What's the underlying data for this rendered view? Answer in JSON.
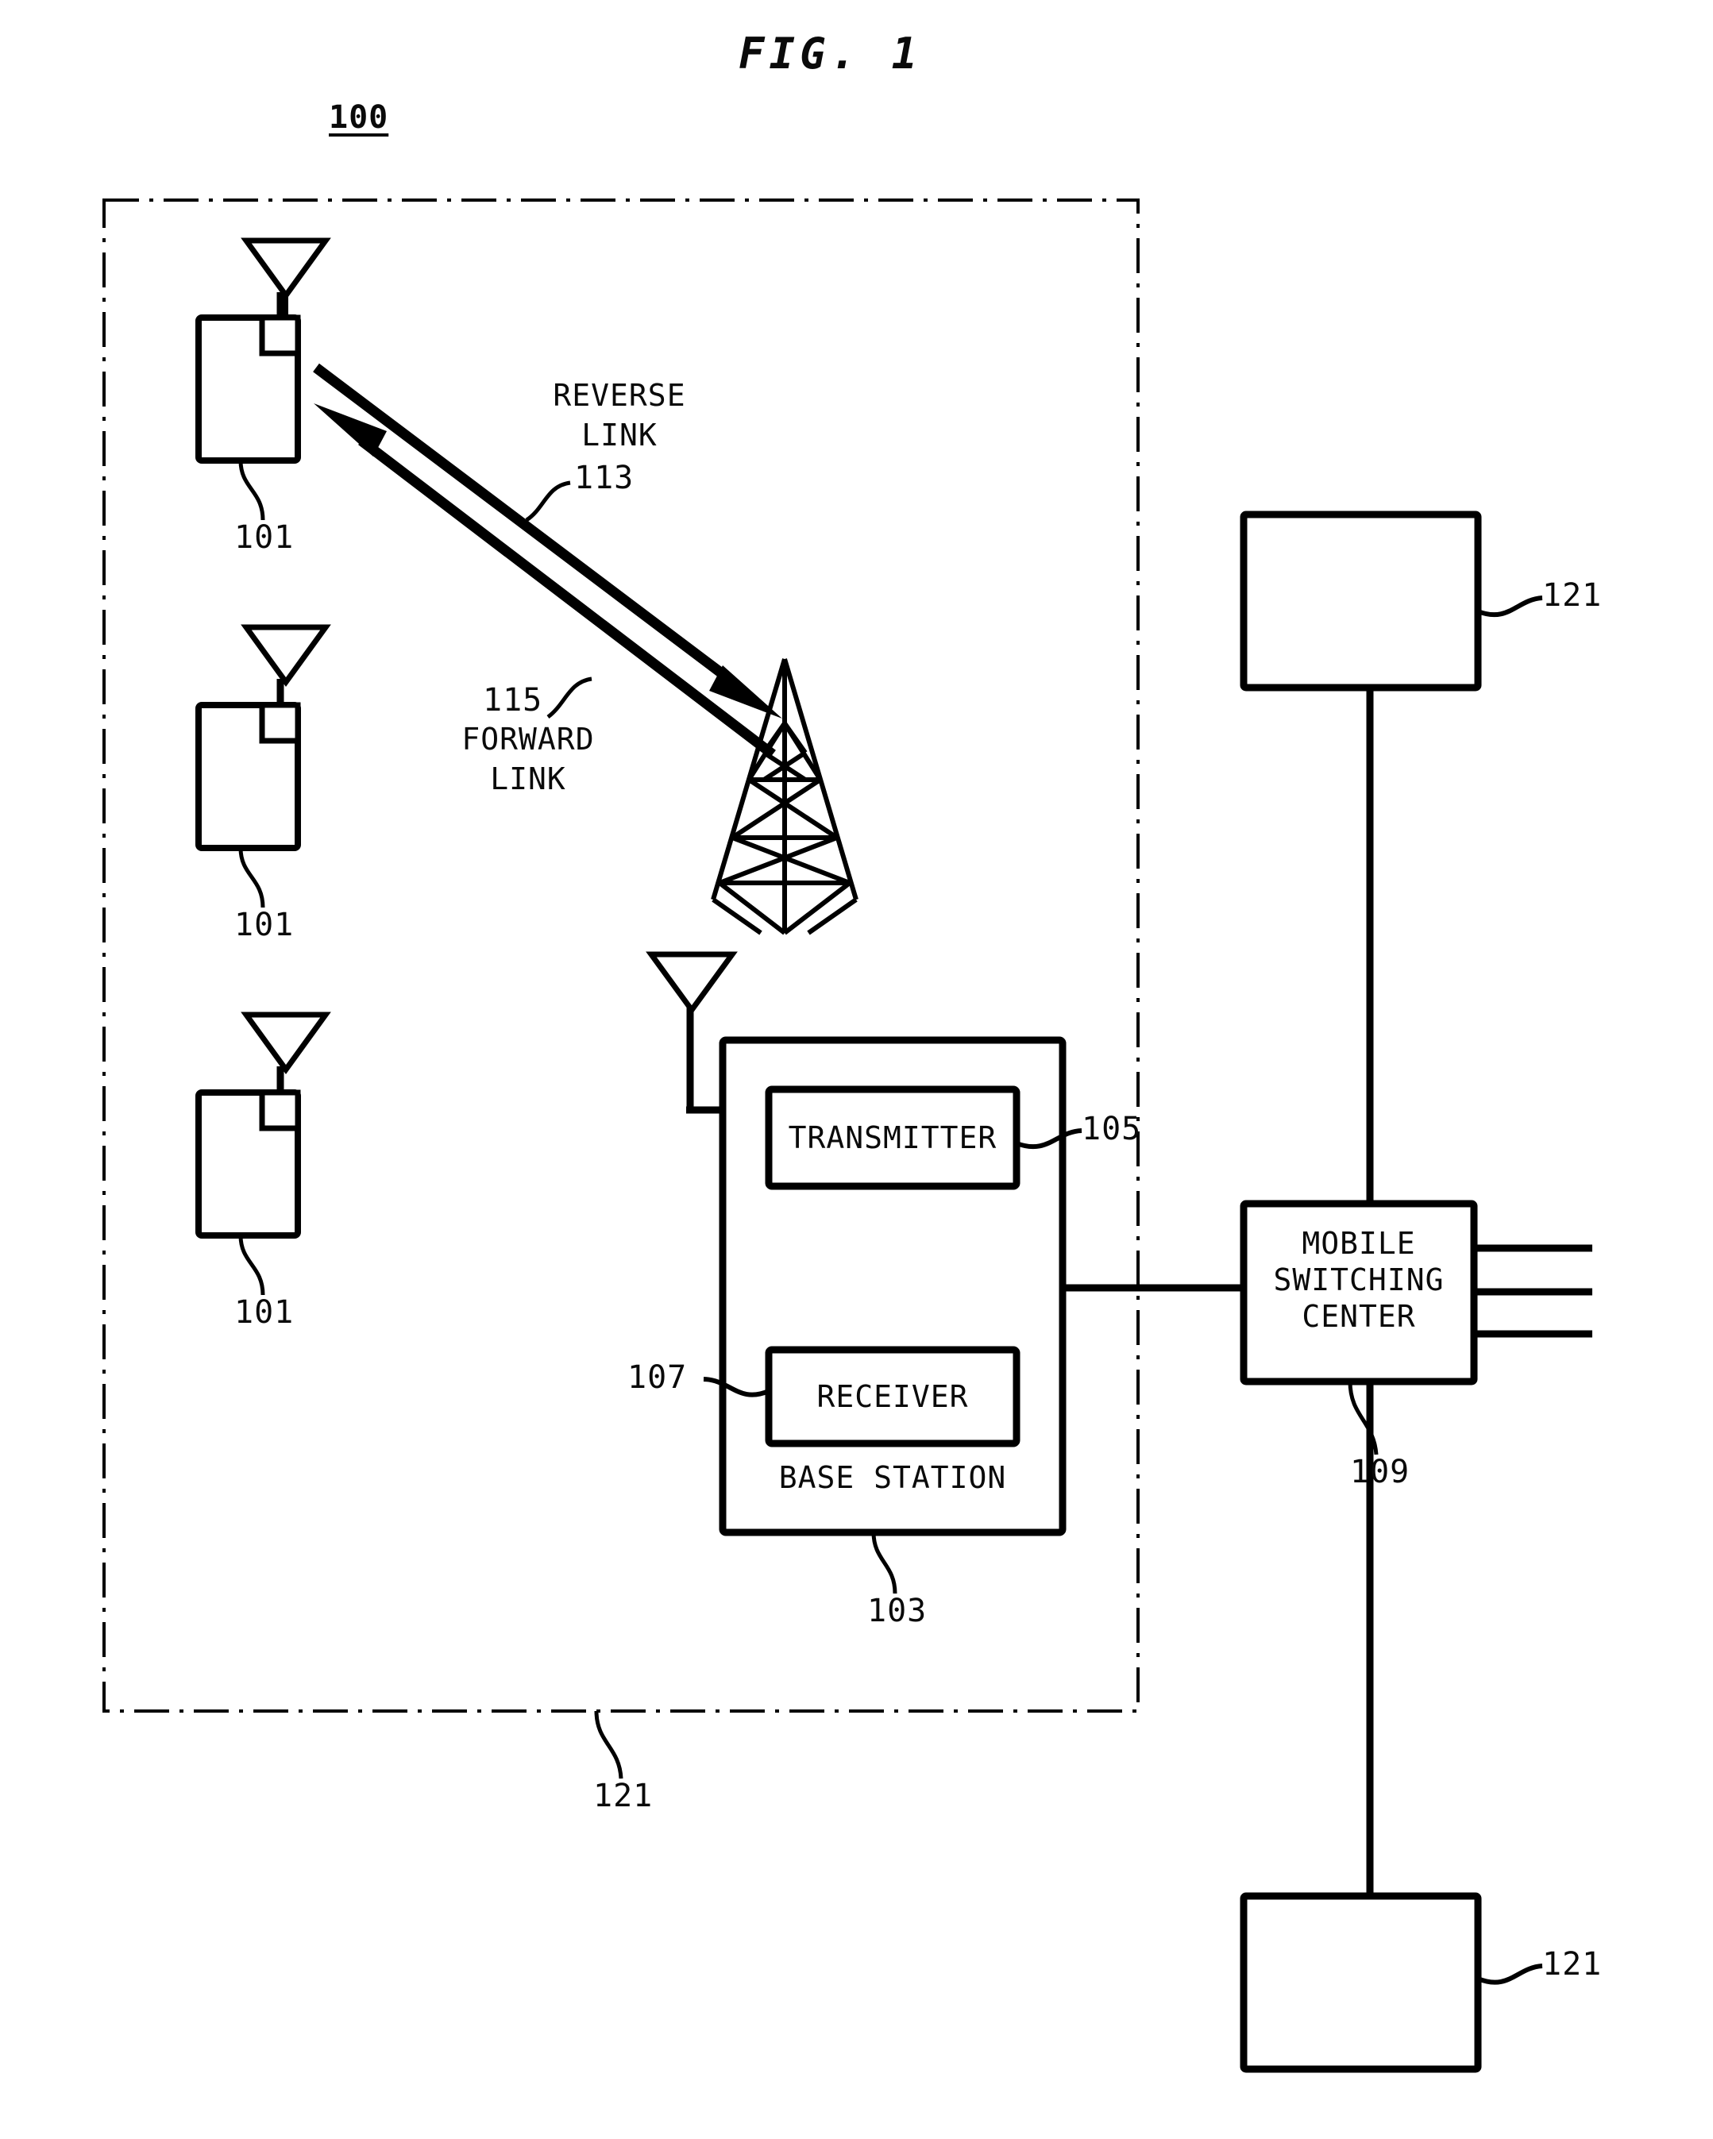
{
  "figure": {
    "title": "FIG. 1",
    "system_number": "100"
  },
  "diagram": {
    "type": "patent-figure",
    "description": "Wireless communication system block diagram",
    "mobile_stations": [
      {
        "ref": "101",
        "name": "mobile-station-1"
      },
      {
        "ref": "101",
        "name": "mobile-station-2"
      },
      {
        "ref": "101",
        "name": "mobile-station-3"
      }
    ],
    "links": [
      {
        "name": "reverse-link",
        "label_line1": "REVERSE",
        "label_line2": "LINK",
        "ref": "113"
      },
      {
        "name": "forward-link",
        "ref": "115",
        "label_line1": "FORWARD",
        "label_line2": "LINK"
      }
    ],
    "base_station": {
      "ref": "103",
      "label": "BASE STATION",
      "transmitter": {
        "label": "TRANSMITTER",
        "ref": "105"
      },
      "receiver": {
        "label": "RECEIVER",
        "ref": "107"
      }
    },
    "mobile_switching_center": {
      "ref": "109",
      "label_line1": "MOBILE",
      "label_line2": "SWITCHING",
      "label_line3": "CENTER"
    },
    "network_boundary": {
      "ref": "121"
    },
    "peer_boxes": [
      {
        "ref": "121",
        "name": "peer-network-top"
      },
      {
        "ref": "121",
        "name": "peer-network-bottom"
      }
    ],
    "colors": {
      "ink": "#000000",
      "paper": "#ffffff"
    }
  }
}
